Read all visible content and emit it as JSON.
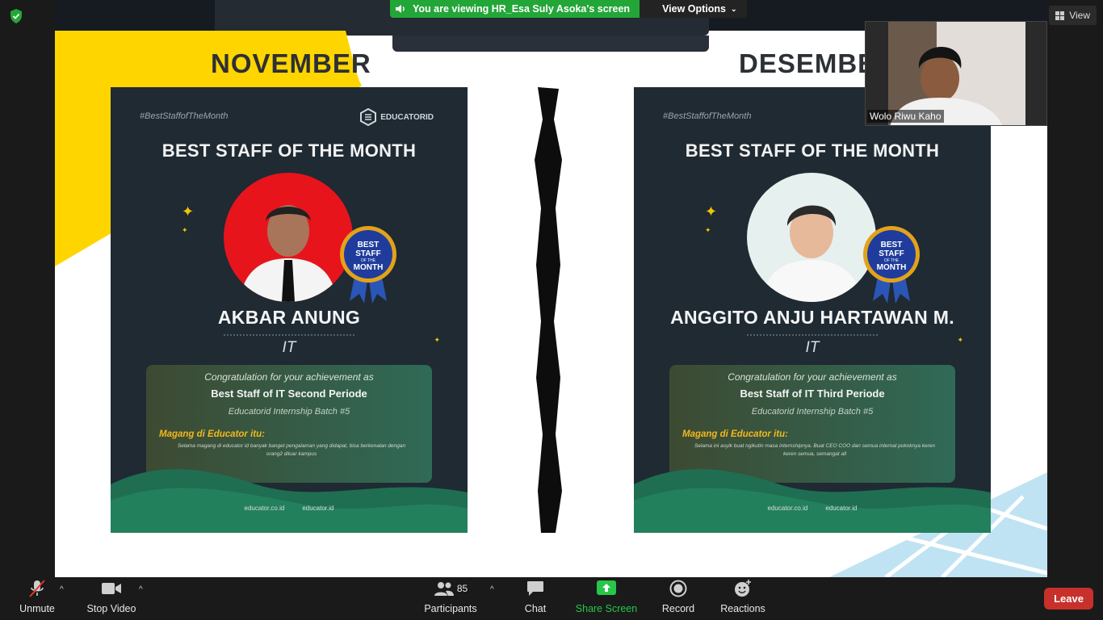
{
  "banner": {
    "viewing_text": "You are viewing HR_Esa Suly Asoka's screen",
    "view_options_label": "View Options"
  },
  "view_button": {
    "label": "View"
  },
  "slide": {
    "left_month": "NOVEMBER",
    "right_month": "DESEMBER",
    "posters": [
      {
        "hashtag": "#BestStaffofTheMonth",
        "brand": "EDUCATORID",
        "heading": "BEST STAFF OF THE MONTH",
        "badge_lines": [
          "BEST",
          "STAFF",
          "OF THE",
          "MONTH"
        ],
        "name": "AKBAR ANUNG",
        "dept": "IT",
        "congrats": "Congratulation for your achievement as",
        "award": "Best Staff of IT Second Periode",
        "batch": "Educatorid Internship Batch #5",
        "magang_title": "Magang di Educator itu:",
        "magang_text": "Selama magang di educator id banyak banget pengalaman yang didapat, bisa berkenalan dengan orang2 diluar kampus",
        "footer_site": "educator.co.id",
        "footer_handle": "educator.id",
        "photo_bg": "#e8141c"
      },
      {
        "hashtag": "#BestStaffofTheMonth",
        "brand": "",
        "heading": "BEST STAFF OF THE MONTH",
        "badge_lines": [
          "BEST",
          "STAFF",
          "OF THE",
          "MONTH"
        ],
        "name": "ANGGITO ANJU HARTAWAN M.",
        "dept": "IT",
        "congrats": "Congratulation for your achievement as",
        "award": "Best Staff of IT Third Periode",
        "batch": "Educatorid Internship Batch #5",
        "magang_title": "Magang di Educator itu:",
        "magang_text": "Selama ini asyik buat ngikutin masa internshipnya. Buat CEO COO dan semua internal pokoknya keren keren semua, semangat all",
        "footer_site": "educator.co.id",
        "footer_handle": "educator.id",
        "photo_bg": "#e6f0ee"
      }
    ]
  },
  "webcam": {
    "participant_name": "Wolo Riwu Kaho"
  },
  "toolbar": {
    "unmute_label": "Unmute",
    "stop_video_label": "Stop Video",
    "participants_label": "Participants",
    "participants_count": "85",
    "chat_label": "Chat",
    "share_screen_label": "Share Screen",
    "record_label": "Record",
    "reactions_label": "Reactions",
    "leave_label": "Leave"
  },
  "colors": {
    "share_green": "#27c64a",
    "leave_red": "#c8302b",
    "banner_green": "#23a638",
    "poster_navy": "#1f2a33",
    "accent_yellow": "#ffd500"
  },
  "icons": [
    "shield-check-icon",
    "speaker-icon",
    "chevron-down-icon",
    "grid-view-icon",
    "mic-muted-icon",
    "video-camera-icon",
    "participants-icon",
    "chat-bubble-icon",
    "share-screen-arrow-icon",
    "record-icon",
    "reactions-icon"
  ]
}
